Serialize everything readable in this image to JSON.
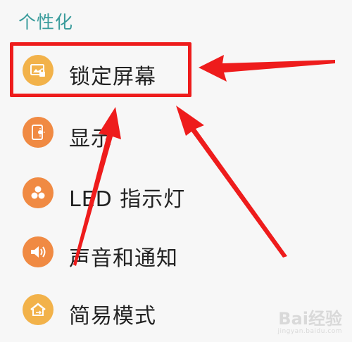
{
  "section": {
    "title": "个性化"
  },
  "items": [
    {
      "label": "锁定屏幕",
      "icon": "lock-screen-icon",
      "color": "#f2b24a"
    },
    {
      "label": "显示",
      "icon": "display-icon",
      "color": "#f08a43"
    },
    {
      "label": "LED 指示灯",
      "icon": "led-indicator-icon",
      "color": "#f08a43"
    },
    {
      "label": "声音和通知",
      "icon": "speaker-icon",
      "color": "#f08a43"
    },
    {
      "label": "简易模式",
      "icon": "easy-mode-home-icon",
      "color": "#f2b24a"
    }
  ],
  "colors": {
    "accent": "#3a9c9c",
    "highlight": "#ee1c1c"
  },
  "watermark": {
    "logo": "Bai经验",
    "url": "jingyan.baidu.com"
  }
}
